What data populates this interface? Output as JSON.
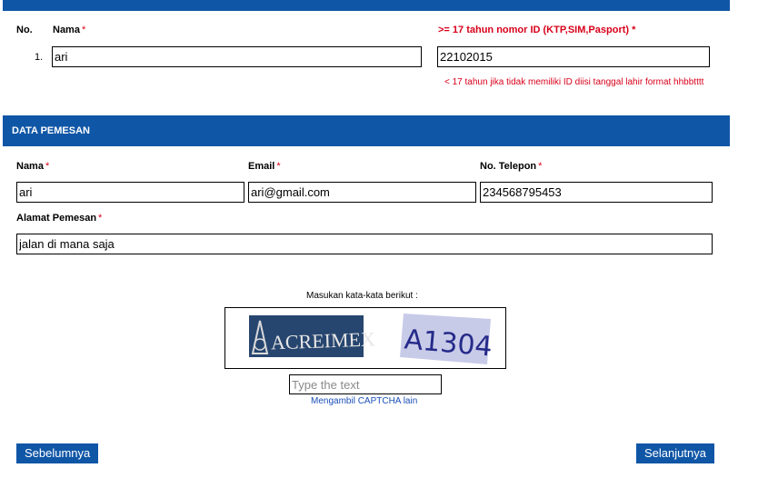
{
  "passenger": {
    "col_no": "No.",
    "col_nama": "Nama",
    "col_id": ">= 17 tahun nomor ID (KTP,SIM,Pasport)",
    "required_mark": "*",
    "rows": [
      {
        "no": "1.",
        "nama": "ari",
        "id": "22102015"
      }
    ],
    "id_note": "< 17 tahun jika tidak memiliki ID diisi tanggal lahir format hhbbtttt"
  },
  "pemesan": {
    "section_title": "DATA PEMESAN",
    "nama_label": "Nama",
    "email_label": "Email",
    "telepon_label": "No. Telepon",
    "alamat_label": "Alamat Pemesan",
    "required_mark": "*",
    "nama_value": "ari",
    "email_value": "ari@gmail.com",
    "telepon_value": "234568795453",
    "alamat_value": "jalan di mana saja"
  },
  "captcha": {
    "instruction": "Masukan kata-kata berikut :",
    "word1": "ACREIMEX",
    "word2": "A1304",
    "input_placeholder": "Type the text",
    "refresh_link": "Mengambil CAPTCHA lain"
  },
  "nav": {
    "prev_label": "Sebelumnya",
    "next_label": "Selanjutnya"
  },
  "colors": {
    "brand_blue": "#0f56a6",
    "required_red": "#d8001a",
    "link_blue": "#1b4fb8"
  }
}
